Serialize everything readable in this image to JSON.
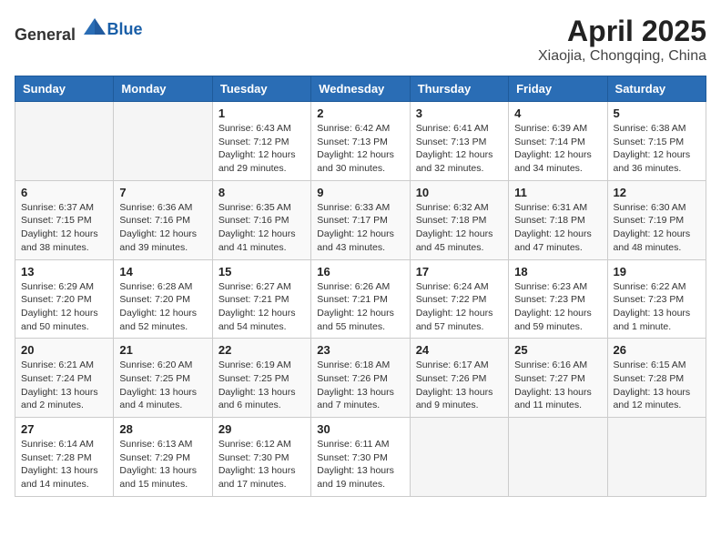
{
  "header": {
    "logo_general": "General",
    "logo_blue": "Blue",
    "month": "April 2025",
    "location": "Xiaojia, Chongqing, China"
  },
  "weekdays": [
    "Sunday",
    "Monday",
    "Tuesday",
    "Wednesday",
    "Thursday",
    "Friday",
    "Saturday"
  ],
  "weeks": [
    [
      {
        "day": "",
        "info": ""
      },
      {
        "day": "",
        "info": ""
      },
      {
        "day": "1",
        "info": "Sunrise: 6:43 AM\nSunset: 7:12 PM\nDaylight: 12 hours and 29 minutes."
      },
      {
        "day": "2",
        "info": "Sunrise: 6:42 AM\nSunset: 7:13 PM\nDaylight: 12 hours and 30 minutes."
      },
      {
        "day": "3",
        "info": "Sunrise: 6:41 AM\nSunset: 7:13 PM\nDaylight: 12 hours and 32 minutes."
      },
      {
        "day": "4",
        "info": "Sunrise: 6:39 AM\nSunset: 7:14 PM\nDaylight: 12 hours and 34 minutes."
      },
      {
        "day": "5",
        "info": "Sunrise: 6:38 AM\nSunset: 7:15 PM\nDaylight: 12 hours and 36 minutes."
      }
    ],
    [
      {
        "day": "6",
        "info": "Sunrise: 6:37 AM\nSunset: 7:15 PM\nDaylight: 12 hours and 38 minutes."
      },
      {
        "day": "7",
        "info": "Sunrise: 6:36 AM\nSunset: 7:16 PM\nDaylight: 12 hours and 39 minutes."
      },
      {
        "day": "8",
        "info": "Sunrise: 6:35 AM\nSunset: 7:16 PM\nDaylight: 12 hours and 41 minutes."
      },
      {
        "day": "9",
        "info": "Sunrise: 6:33 AM\nSunset: 7:17 PM\nDaylight: 12 hours and 43 minutes."
      },
      {
        "day": "10",
        "info": "Sunrise: 6:32 AM\nSunset: 7:18 PM\nDaylight: 12 hours and 45 minutes."
      },
      {
        "day": "11",
        "info": "Sunrise: 6:31 AM\nSunset: 7:18 PM\nDaylight: 12 hours and 47 minutes."
      },
      {
        "day": "12",
        "info": "Sunrise: 6:30 AM\nSunset: 7:19 PM\nDaylight: 12 hours and 48 minutes."
      }
    ],
    [
      {
        "day": "13",
        "info": "Sunrise: 6:29 AM\nSunset: 7:20 PM\nDaylight: 12 hours and 50 minutes."
      },
      {
        "day": "14",
        "info": "Sunrise: 6:28 AM\nSunset: 7:20 PM\nDaylight: 12 hours and 52 minutes."
      },
      {
        "day": "15",
        "info": "Sunrise: 6:27 AM\nSunset: 7:21 PM\nDaylight: 12 hours and 54 minutes."
      },
      {
        "day": "16",
        "info": "Sunrise: 6:26 AM\nSunset: 7:21 PM\nDaylight: 12 hours and 55 minutes."
      },
      {
        "day": "17",
        "info": "Sunrise: 6:24 AM\nSunset: 7:22 PM\nDaylight: 12 hours and 57 minutes."
      },
      {
        "day": "18",
        "info": "Sunrise: 6:23 AM\nSunset: 7:23 PM\nDaylight: 12 hours and 59 minutes."
      },
      {
        "day": "19",
        "info": "Sunrise: 6:22 AM\nSunset: 7:23 PM\nDaylight: 13 hours and 1 minute."
      }
    ],
    [
      {
        "day": "20",
        "info": "Sunrise: 6:21 AM\nSunset: 7:24 PM\nDaylight: 13 hours and 2 minutes."
      },
      {
        "day": "21",
        "info": "Sunrise: 6:20 AM\nSunset: 7:25 PM\nDaylight: 13 hours and 4 minutes."
      },
      {
        "day": "22",
        "info": "Sunrise: 6:19 AM\nSunset: 7:25 PM\nDaylight: 13 hours and 6 minutes."
      },
      {
        "day": "23",
        "info": "Sunrise: 6:18 AM\nSunset: 7:26 PM\nDaylight: 13 hours and 7 minutes."
      },
      {
        "day": "24",
        "info": "Sunrise: 6:17 AM\nSunset: 7:26 PM\nDaylight: 13 hours and 9 minutes."
      },
      {
        "day": "25",
        "info": "Sunrise: 6:16 AM\nSunset: 7:27 PM\nDaylight: 13 hours and 11 minutes."
      },
      {
        "day": "26",
        "info": "Sunrise: 6:15 AM\nSunset: 7:28 PM\nDaylight: 13 hours and 12 minutes."
      }
    ],
    [
      {
        "day": "27",
        "info": "Sunrise: 6:14 AM\nSunset: 7:28 PM\nDaylight: 13 hours and 14 minutes."
      },
      {
        "day": "28",
        "info": "Sunrise: 6:13 AM\nSunset: 7:29 PM\nDaylight: 13 hours and 15 minutes."
      },
      {
        "day": "29",
        "info": "Sunrise: 6:12 AM\nSunset: 7:30 PM\nDaylight: 13 hours and 17 minutes."
      },
      {
        "day": "30",
        "info": "Sunrise: 6:11 AM\nSunset: 7:30 PM\nDaylight: 13 hours and 19 minutes."
      },
      {
        "day": "",
        "info": ""
      },
      {
        "day": "",
        "info": ""
      },
      {
        "day": "",
        "info": ""
      }
    ]
  ]
}
